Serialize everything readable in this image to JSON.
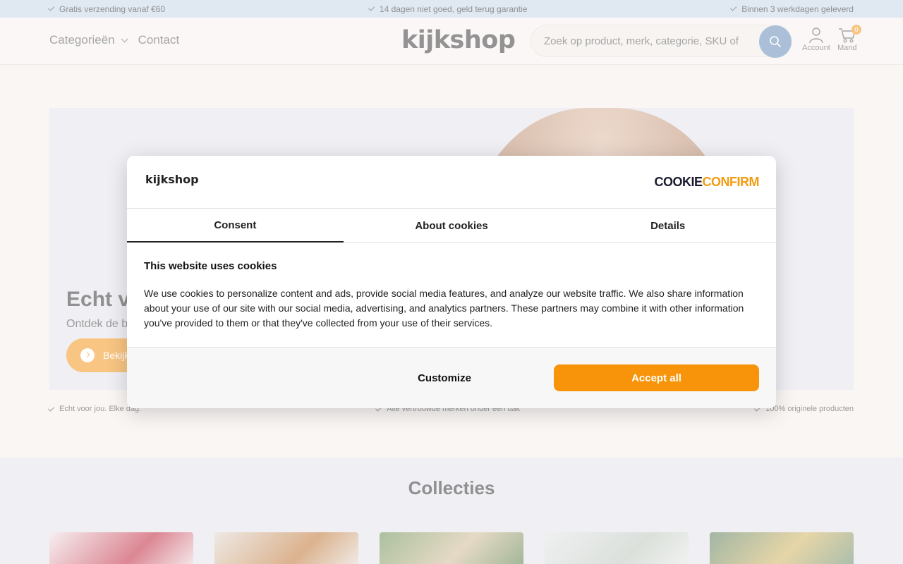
{
  "topbar": {
    "usps": [
      "Gratis verzending vanaf €60",
      "14 dagen niet goed, geld terug garantie",
      "Binnen 3 werkdagen geleverd"
    ]
  },
  "header": {
    "nav": {
      "categories": "Categorieën",
      "contact": "Contact"
    },
    "logo": "kijkshop",
    "search_placeholder": "Zoek op product, merk, categorie, SKU of",
    "account_label": "Account",
    "cart_label": "Mand",
    "cart_count": "0"
  },
  "hero": {
    "title": "Echt vo",
    "subtitle": "Ontdek de be",
    "cta": "Bekijk"
  },
  "usp_row": [
    "Echt voor jou. Elke dag.",
    "Alle vertrouwde merken onder één dak",
    "100% originele producten"
  ],
  "collections": {
    "title": "Collecties"
  },
  "cookie_dialog": {
    "logo": "kijkshop",
    "brand_part1": "COOKIE",
    "brand_part2": "CONFIRM",
    "tabs": [
      "Consent",
      "About cookies",
      "Details"
    ],
    "heading": "This website uses cookies",
    "body": "We use cookies to personalize content and ads, provide social media features, and analyze our website traffic. We also share information about your use of our site with our social media, advertising, and analytics partners. These partners may combine it with other information you've provided to them or that they've collected from your use of their services.",
    "customize_label": "Customize",
    "accept_label": "Accept all"
  },
  "colors": {
    "accent": "#f7940a",
    "topbar": "#cfdcea",
    "search_button": "#7f9fc3"
  }
}
